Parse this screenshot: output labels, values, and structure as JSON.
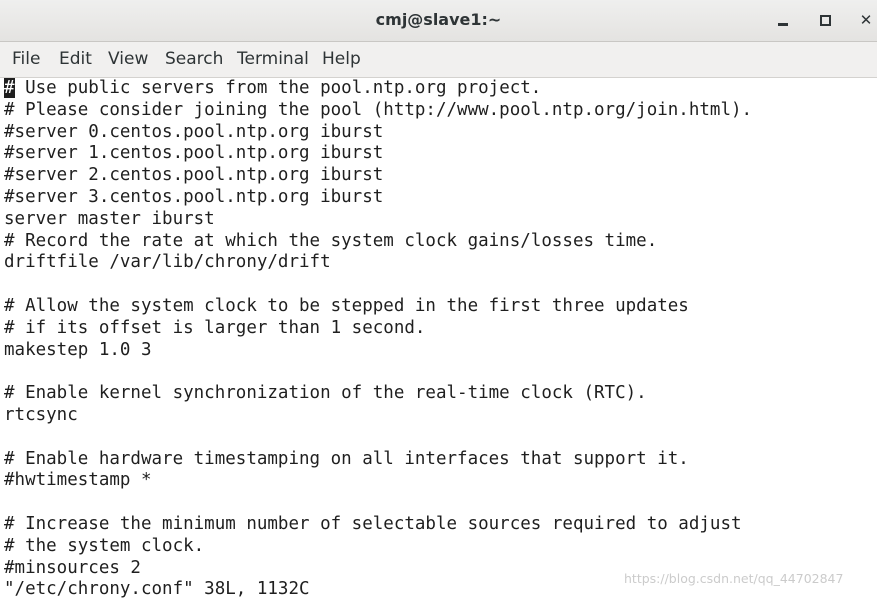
{
  "window": {
    "title": "cmj@slave1:~"
  },
  "menubar": {
    "items": [
      "File",
      "Edit",
      "View",
      "Search",
      "Terminal",
      "Help"
    ]
  },
  "terminal": {
    "cursor_char": "#",
    "lines": [
      " Use public servers from the pool.ntp.org project.",
      "# Please consider joining the pool (http://www.pool.ntp.org/join.html).",
      "#server 0.centos.pool.ntp.org iburst",
      "#server 1.centos.pool.ntp.org iburst",
      "#server 2.centos.pool.ntp.org iburst",
      "#server 3.centos.pool.ntp.org iburst",
      "server master iburst",
      "# Record the rate at which the system clock gains/losses time.",
      "driftfile /var/lib/chrony/drift",
      "",
      "# Allow the system clock to be stepped in the first three updates",
      "# if its offset is larger than 1 second.",
      "makestep 1.0 3",
      "",
      "# Enable kernel synchronization of the real-time clock (RTC).",
      "rtcsync",
      "",
      "# Enable hardware timestamping on all interfaces that support it.",
      "#hwtimestamp *",
      "",
      "# Increase the minimum number of selectable sources required to adjust",
      "# the system clock.",
      "#minsources 2",
      "\"/etc/chrony.conf\" 38L, 1132C"
    ]
  },
  "watermark": {
    "text": "https://blog.csdn.net/qq_44702847"
  }
}
